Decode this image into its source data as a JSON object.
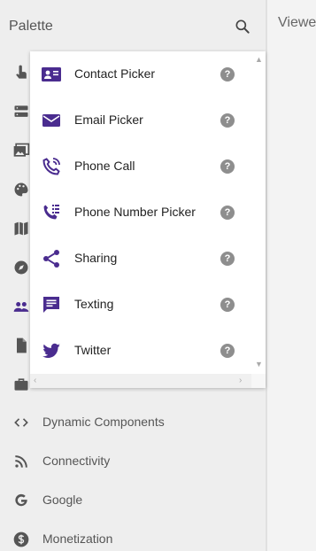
{
  "palette": {
    "title": "Palette",
    "search_icon": "search-icon"
  },
  "viewer": {
    "title": "Viewer"
  },
  "side_icons": [
    "touch-icon",
    "storage-icon",
    "media-icon",
    "palette-icon",
    "map-icon",
    "compass-icon",
    "people-icon",
    "file-icon",
    "briefcase-icon"
  ],
  "popup": {
    "items": [
      {
        "label": "Contact Picker",
        "icon": "contact-card-icon",
        "help": "?"
      },
      {
        "label": "Email Picker",
        "icon": "email-icon",
        "help": "?"
      },
      {
        "label": "Phone Call",
        "icon": "phone-call-icon",
        "help": "?"
      },
      {
        "label": "Phone Number Picker",
        "icon": "dialpad-phone-icon",
        "help": "?"
      },
      {
        "label": "Sharing",
        "icon": "share-icon",
        "help": "?"
      },
      {
        "label": "Texting",
        "icon": "message-icon",
        "help": "?"
      },
      {
        "label": "Twitter",
        "icon": "twitter-bird-icon",
        "help": "?"
      }
    ]
  },
  "categories": [
    {
      "label": "Dynamic Components",
      "icon": "code-brackets-icon"
    },
    {
      "label": "Connectivity",
      "icon": "rss-icon"
    },
    {
      "label": "Google",
      "icon": "google-g-icon"
    },
    {
      "label": "Monetization",
      "icon": "dollar-icon"
    }
  ],
  "colors": {
    "accent": "#4a2c8f",
    "icon_gray": "#555555",
    "help_gray": "#8e8e8e"
  }
}
